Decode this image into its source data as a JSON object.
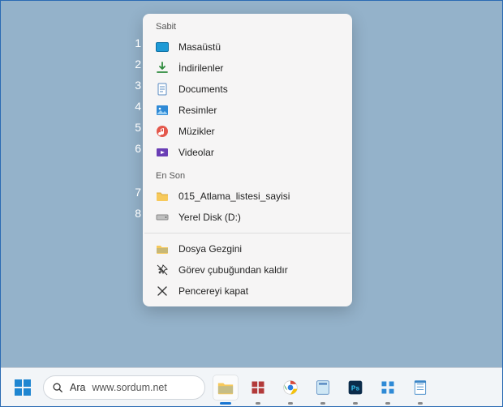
{
  "jumplist": {
    "pinned_header": "Sabit",
    "recent_header": "En Son",
    "pinned": [
      {
        "num": "1",
        "label": "Masaüstü"
      },
      {
        "num": "2",
        "label": "İndirilenler"
      },
      {
        "num": "3",
        "label": "Documents"
      },
      {
        "num": "4",
        "label": "Resimler"
      },
      {
        "num": "5",
        "label": "Müzikler"
      },
      {
        "num": "6",
        "label": "Videolar"
      }
    ],
    "recent": [
      {
        "num": "7",
        "label": "015_Atlama_listesi_sayisi"
      },
      {
        "num": "8",
        "label": "Yerel Disk (D:)"
      }
    ],
    "tasks": {
      "open": "Dosya Gezgini",
      "unpin": "Görev çubuğundan kaldır",
      "close": "Pencereyi kapat"
    }
  },
  "taskbar": {
    "search_label": "Ara",
    "search_term": "www.sordum.net"
  }
}
